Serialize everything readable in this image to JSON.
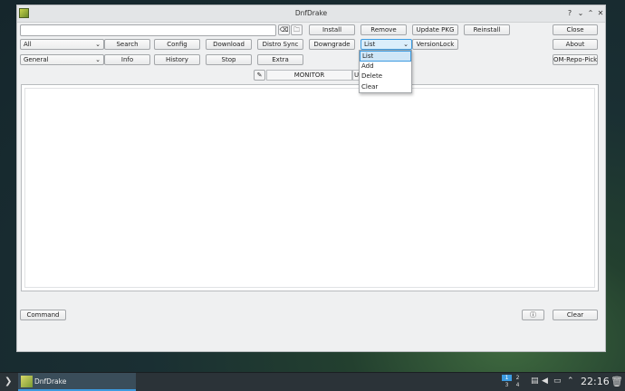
{
  "window": {
    "title": "DnfDrake",
    "controls": {
      "help": "?",
      "minimize": "⌄",
      "maximize": "⌃",
      "close": "✕"
    }
  },
  "toolbar": {
    "search_value": "",
    "clear_icon": "⌫",
    "folder_icon": "🗀",
    "install": "Install",
    "remove": "Remove",
    "update_pkg": "Update PKG",
    "reinstall": "Reinstall",
    "close": "Close",
    "repo_combo": "All",
    "search": "Search",
    "config": "Config",
    "download": "Download",
    "distro_sync": "Distro Sync",
    "downgrade": "Downgrade",
    "list_combo": "List",
    "versionlock": "VersionLock",
    "about": "About",
    "info_combo": "General",
    "info": "Info",
    "history": "History",
    "stop": "Stop",
    "extra": "Extra",
    "om_repo_picker": "OM-Repo-Picker"
  },
  "output": {
    "pin_icon": "✎",
    "monitor_header": "MONITOR",
    "second_header": "US"
  },
  "dropdown": {
    "items": [
      "List",
      "Add",
      "Delete",
      "Clear"
    ],
    "selected": "List"
  },
  "bottom": {
    "command": "Command",
    "info_icon": "ⓘ",
    "clear": "Clear"
  },
  "taskbar": {
    "launcher_icon": "❯",
    "task_label": "DnfDrake",
    "pager": [
      "1",
      "2",
      "3",
      "4"
    ],
    "clock": "22:16",
    "tray_icons": [
      "clipboard-icon",
      "volume-icon",
      "network-icon",
      "arrow-up-icon",
      "trash-icon"
    ]
  },
  "colors": {
    "accent": "#3d9be0",
    "window_bg": "#eff0f1",
    "taskbar_bg": "#2b3338"
  }
}
